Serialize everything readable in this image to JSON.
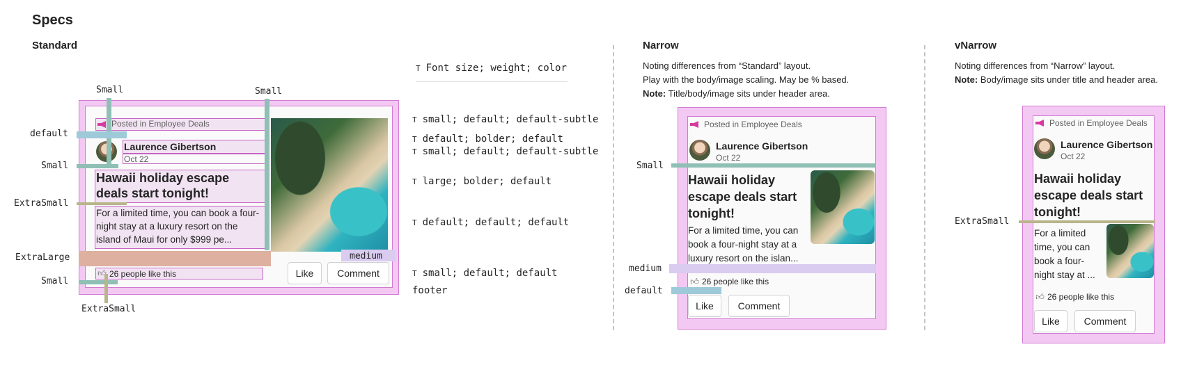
{
  "page": {
    "heading": "Specs"
  },
  "standard": {
    "heading": "Standard",
    "labels": {
      "small_top_left": "Small",
      "small_top_right": "Small",
      "default": "default",
      "small_mid": "Small",
      "extrasmall_left": "ExtraSmall",
      "extralarge": "ExtraLarge",
      "small_bottom": "Small",
      "extrasmall_bottom": "ExtraSmall",
      "medium": "medium"
    },
    "specs": {
      "legend_icon": "T",
      "legend": "Font size; weight; color",
      "header": "small; default; default-subtle",
      "author": "default; bolder; default",
      "date": "small; default; default-subtle",
      "title": "large; bolder; default",
      "body": "default; default; default",
      "likes": "small; default; default",
      "footer": "footer"
    }
  },
  "narrow": {
    "heading": "Narrow",
    "note1": "Noting differences from “Standard” layout.",
    "note2": "Play with the body/image scaling. May be % based.",
    "note_bold": "Note:",
    "note3": "Title/body/image sits under header area.",
    "labels": {
      "small": "Small",
      "medium": "medium",
      "default": "default"
    }
  },
  "vnarrow": {
    "heading": "vNarrow",
    "note1": "Noting differences from “Narrow” layout.",
    "note_bold": "Note:",
    "note2": "Body/image sits under title and header area.",
    "labels": {
      "extrasmall": "ExtraSmall"
    }
  },
  "card": {
    "posted_in": "Posted in Employee Deals",
    "author": "Laurence Gibertson",
    "date": "Oct 22",
    "title_standard": "Hawaii holiday escape deals start tonight!",
    "title_narrow": "Hawaii holiday escape deals start tonight!",
    "body_standard": "For a limited time, you can book a four-night stay at a luxury resort on the island of Maui for only $999 pe...",
    "body_narrow": "For a limited time, you can book a four-night stay at a luxury resort on the islan...",
    "body_vnarrow": "For a limited time, you can book a four-night stay at ...",
    "likes": "26 people like this",
    "like_button": "Like",
    "comment_button": "Comment",
    "icons": {
      "posted": "megaphone-icon",
      "like": "thumbs-up-icon"
    },
    "colors": {
      "padding": "#f3c9f3",
      "outline": "#d27ad2",
      "accent": "#d63aa0",
      "small_spacer": "#8fbfb5",
      "default_spacer": "#9ec9d9",
      "extralarge_spacer": "#ddb0a0",
      "medium_spacer": "#d9ccf0",
      "extrasmall_spacer": "#b8b58a"
    }
  }
}
